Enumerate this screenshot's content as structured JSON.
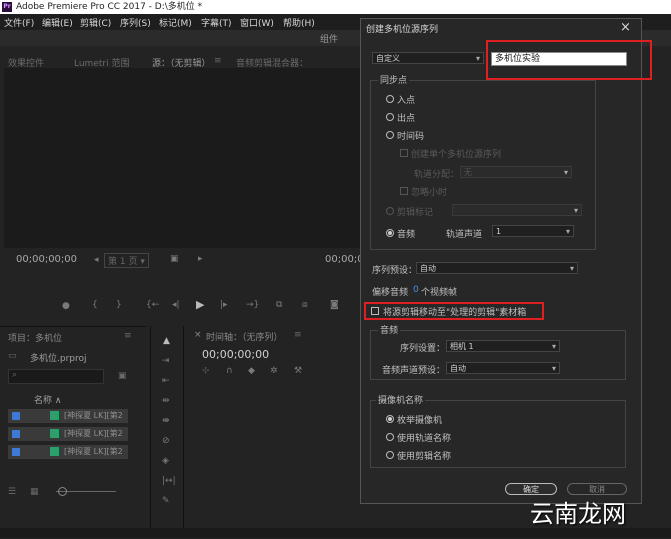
{
  "window": {
    "title": "Adobe Premiere Pro CC 2017 - D:\\多机位 *",
    "app_icon": "Pr"
  },
  "menu": [
    {
      "label": "文件(F)"
    },
    {
      "label": "编辑(E)"
    },
    {
      "label": "剪辑(C)"
    },
    {
      "label": "序列(S)"
    },
    {
      "label": "标记(M)"
    },
    {
      "label": "字幕(T)"
    },
    {
      "label": "窗口(W)"
    },
    {
      "label": "帮助(H)"
    }
  ],
  "workspace": {
    "label": "组件"
  },
  "source_panel": {
    "tabs": [
      {
        "label": "效果控件"
      },
      {
        "label": "Lumetri 范围"
      },
      {
        "label": "源：（无剪辑）"
      },
      {
        "label": "音频剪辑混合器："
      }
    ],
    "timecode_left": "00;00;00;00",
    "page_select": "第 1 页",
    "timecode_right": "00;00;00"
  },
  "project_panel": {
    "title": "项目：多机位",
    "file": "多机位.prproj",
    "column_name": "名称",
    "rows": [
      {
        "label": "[神探夏 LK][第2"
      },
      {
        "label": "[神探夏 LK][第2"
      },
      {
        "label": "[神探夏 LK][第2"
      }
    ]
  },
  "timeline_panel": {
    "title": "时间轴：（无序列）",
    "timecode": "00;00;00;00"
  },
  "dialog": {
    "title": "创建多机位源序列",
    "name_preset": "自定义",
    "name_value": "多机位实验",
    "sync_group_label": "同步点",
    "sync_in": "入点",
    "sync_out": "出点",
    "sync_timecode": "时间码",
    "single_source": "创建单个多机位源序列",
    "track_assign_label": "轨道分配：",
    "track_assign_value": "无",
    "ignore_hours": "忽略小时",
    "clip_marker": "剪辑标记",
    "audio_label": "音频",
    "track_channel_label": "轨道声道",
    "track_channel_value": "1",
    "sequence_preset_label": "序列预设：",
    "sequence_preset_value": "自动",
    "offset_label": "偏移音频",
    "offset_value": "0",
    "offset_unit": "个视频帧",
    "move_clips_label": "将源剪辑移动至\"处理的剪辑\"素材箱",
    "audio_group_label": "音频",
    "seq_setting_label": "序列设置：",
    "seq_setting_value": "相机 1",
    "audio_channel_preset_label": "音频声道预设：",
    "audio_channel_preset_value": "自动",
    "camera_group_label": "摄像机名称",
    "camera_enum": "枚举摄像机",
    "camera_track": "使用轨道名称",
    "camera_clip": "使用剪辑名称",
    "ok_label": "确定",
    "cancel_label": "取消"
  },
  "watermark": "云南龙网",
  "colors": {
    "highlight": "#e02020",
    "link_blue": "#3d7ad6"
  }
}
